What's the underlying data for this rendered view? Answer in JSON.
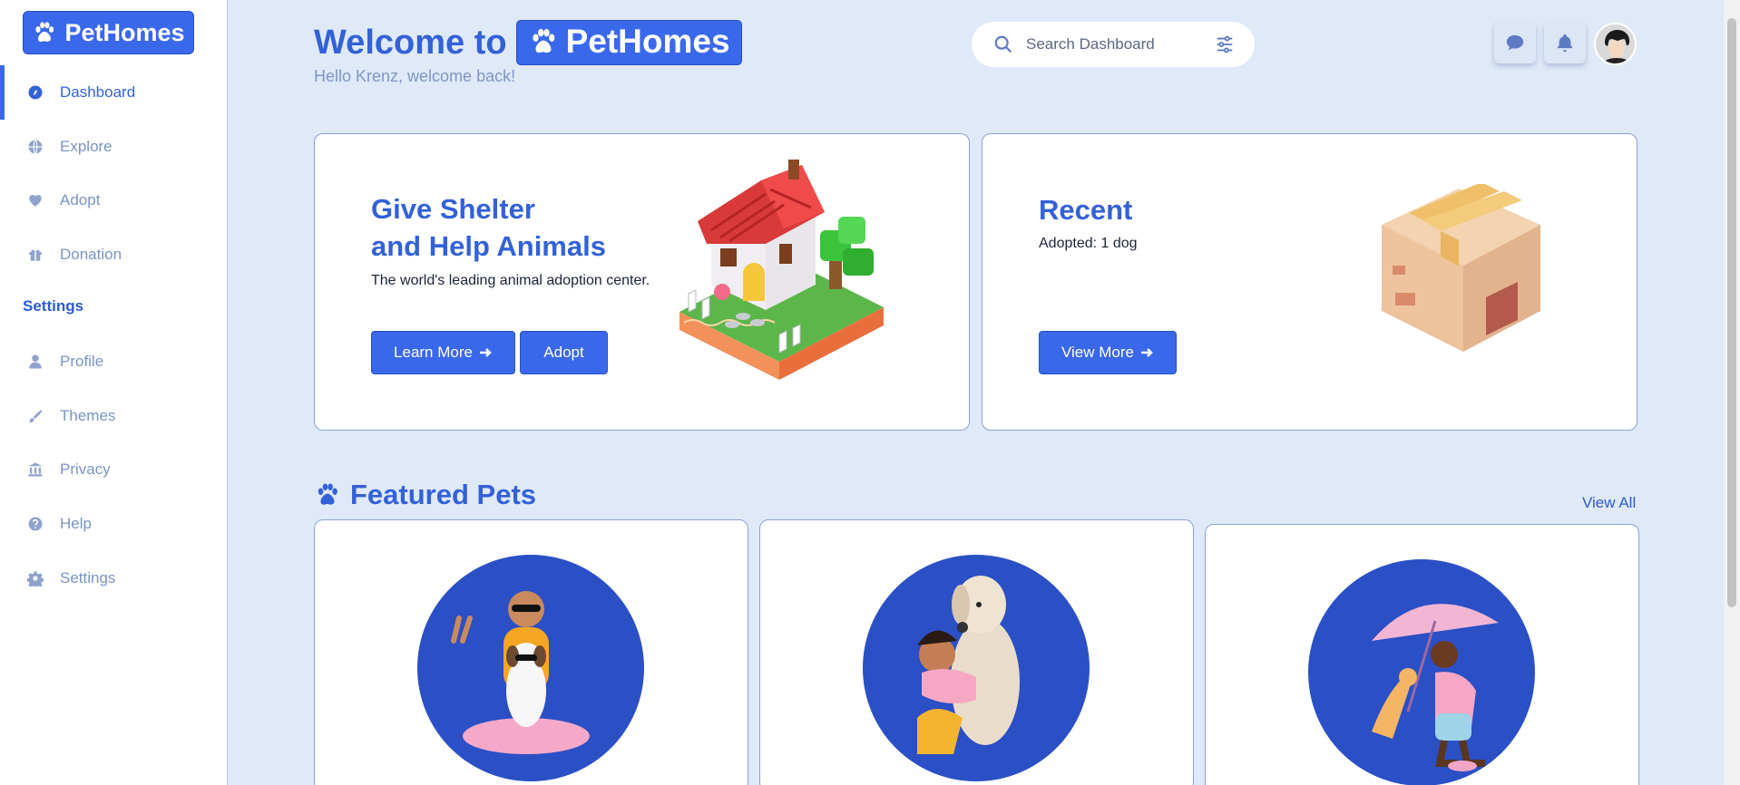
{
  "brand": {
    "name": "PetHomes",
    "accent": "#3a68ea",
    "background": "#dfe9f8"
  },
  "sidebar": {
    "items": [
      {
        "label": "Dashboard",
        "icon": "compass-icon",
        "active": true
      },
      {
        "label": "Explore",
        "icon": "globe-icon"
      },
      {
        "label": "Adopt",
        "icon": "heart-icon"
      },
      {
        "label": "Donation",
        "icon": "gift-icon"
      }
    ],
    "section_label": "Settings",
    "settings_items": [
      {
        "label": "Profile",
        "icon": "user-icon"
      },
      {
        "label": "Themes",
        "icon": "brush-icon"
      },
      {
        "label": "Privacy",
        "icon": "building-icon"
      },
      {
        "label": "Help",
        "icon": "question-icon"
      },
      {
        "label": "Settings",
        "icon": "gear-icon"
      }
    ]
  },
  "header": {
    "welcome_prefix": "Welcome to",
    "brand_chip": "PetHomes",
    "greeting": "Hello Krenz, welcome back!",
    "search_placeholder": "Search Dashboard"
  },
  "shelter_card": {
    "title_line1": "Give Shelter",
    "title_line2": "and Help Animals",
    "subtitle": "The world's leading animal adoption center.",
    "learn_more": "Learn More",
    "adopt": "Adopt"
  },
  "recent_card": {
    "title": "Recent",
    "subtitle": "Adopted: 1 dog",
    "view_more": "View More"
  },
  "featured": {
    "title": "Featured Pets",
    "view_all": "View All"
  }
}
